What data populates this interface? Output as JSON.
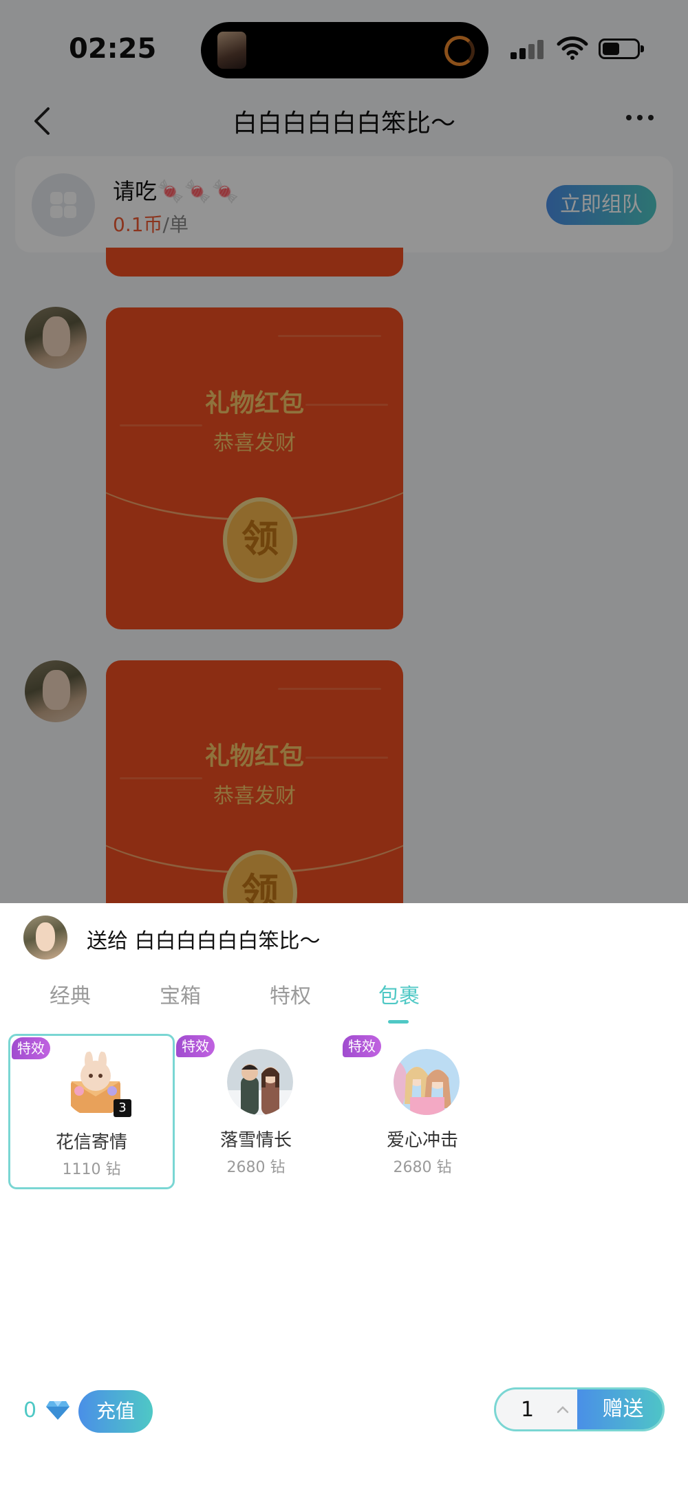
{
  "status_bar": {
    "time": "02:25"
  },
  "header": {
    "title": "白白白白白白笨比～"
  },
  "team_card": {
    "name": "请吃",
    "emoji": "🍬🍬🍬",
    "price_value": "0.1币",
    "price_unit": "/单",
    "button": "立即组队"
  },
  "messages": [
    {
      "title": "礼物红包",
      "subtitle": "恭喜发财",
      "coin": "领"
    },
    {
      "title": "礼物红包",
      "subtitle": "恭喜发财",
      "coin": "领"
    }
  ],
  "gift_sheet": {
    "recipient_prefix": "送给",
    "recipient_name": "白白白白白白笨比～",
    "tabs": [
      "经典",
      "宝箱",
      "特权",
      "包裹"
    ],
    "active_tab": "包裹",
    "gifts": [
      {
        "badge": "特效",
        "name": "花信寄情",
        "price": "1110 钻",
        "count": "3",
        "selected": true,
        "icon": "envelope-bunny-gift-icon"
      },
      {
        "badge": "特效",
        "name": "落雪情长",
        "price": "2680 钻",
        "selected": false,
        "icon": "couple-snow-gift-icon"
      },
      {
        "badge": "特效",
        "name": "爱心冲击",
        "price": "2680 钻",
        "selected": false,
        "icon": "anime-girls-gift-icon"
      }
    ],
    "balance": "0",
    "recharge_label": "充值",
    "quantity": "1",
    "send_label": "赠送"
  },
  "colors": {
    "accent": "#4fc8c5",
    "accent_blue": "#4a8fe7",
    "badge_purple": "#a04ccf",
    "packet_red": "#f04e21"
  }
}
